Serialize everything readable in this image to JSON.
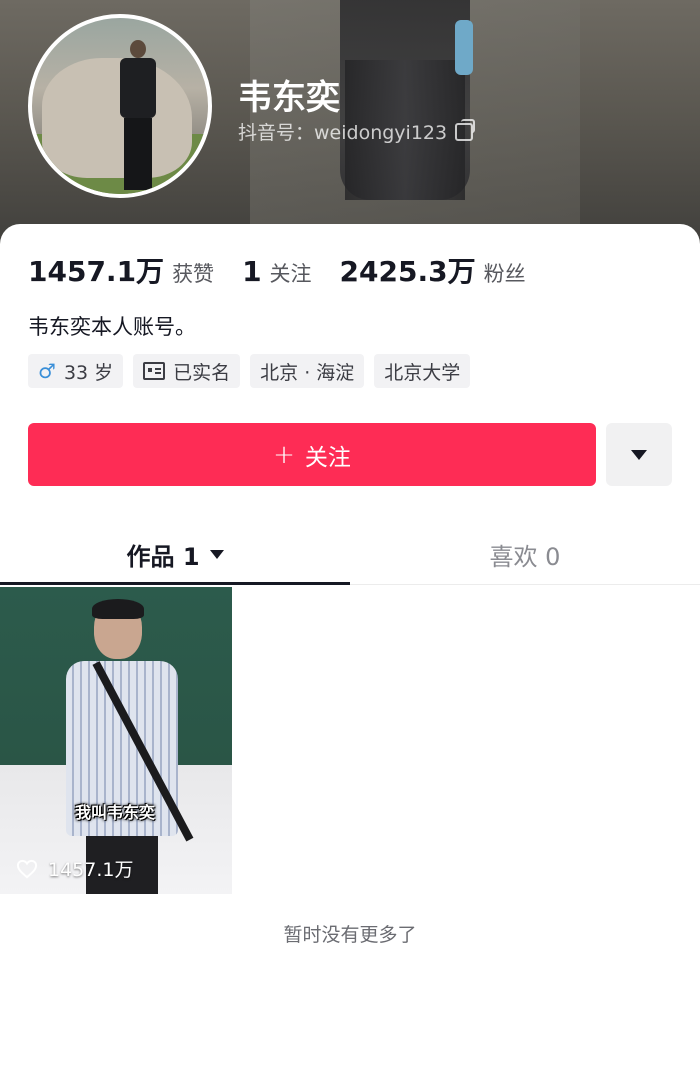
{
  "profile": {
    "name": "韦东奕",
    "douyin_id": "抖音号：weidongyi123",
    "bio": "韦东奕本人账号。"
  },
  "stats": [
    {
      "value": "1457.1万",
      "label": "获赞"
    },
    {
      "value": "1",
      "label": "关注"
    },
    {
      "value": "2425.3万",
      "label": "粉丝"
    }
  ],
  "tags": {
    "age": "33 岁",
    "verified": "已实名",
    "location": "北京 · 海淀",
    "school": "北京大学"
  },
  "actions": {
    "follow_label": "关注"
  },
  "tabs": {
    "works_label": "作品 1",
    "likes_label": "喜欢 0"
  },
  "videos": [
    {
      "caption": "我叫韦东奕",
      "likes": "1457.1万"
    }
  ],
  "footer": {
    "no_more": "暂时没有更多了"
  },
  "colors": {
    "accent": "#fe2c55",
    "male": "#3a8fd8"
  }
}
